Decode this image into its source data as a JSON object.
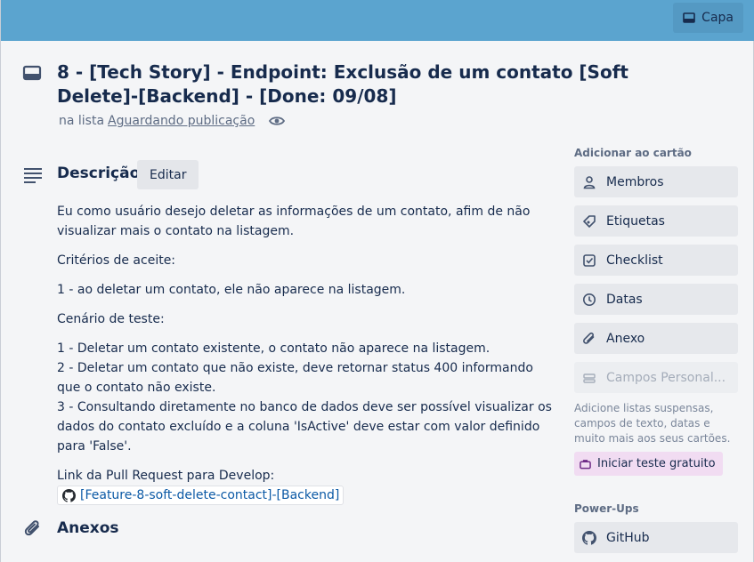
{
  "cover": {
    "button_label": "Capa",
    "color": "#5ba4cf"
  },
  "card": {
    "title": "8 - [Tech Story] - Endpoint: Exclusão de um contato [Soft Delete]-[Backend] - [Done: 09/08]",
    "in_list_prefix": "na lista",
    "list_name": "Aguardando publicação"
  },
  "description": {
    "heading": "Descrição",
    "edit_label": "Editar",
    "paragraphs": [
      "Eu como usuário desejo deletar as informações de um contato, afim de não visualizar mais o contato na listagem.",
      "Critérios de aceite:",
      "1 - ao deletar um contato, ele não aparece na listagem.",
      "Cenário de teste:"
    ],
    "scenarios": [
      "1 - Deletar um contato existente, o contato não aparece na listagem.",
      "2 - Deletar um contato que não existe, deve retornar status 400 informando que o contato não existe.",
      "3 - Consultando diretamente no banco de dados deve ser possível visualizar os dados do contato excluído e a coluna 'IsActive' deve estar com valor definido para 'False'."
    ],
    "pr_prefix": "Link da Pull Request para Develop:",
    "pr_link": "[Feature-8-soft-delete-contact]-[Backend]"
  },
  "attachments": {
    "heading": "Anexos"
  },
  "sidebar": {
    "add_heading": "Adicionar ao cartão",
    "buttons": [
      {
        "label": "Membros",
        "icon": "person-icon"
      },
      {
        "label": "Etiquetas",
        "icon": "tag-icon"
      },
      {
        "label": "Checklist",
        "icon": "checkbox-icon"
      },
      {
        "label": "Datas",
        "icon": "clock-icon"
      },
      {
        "label": "Anexo",
        "icon": "paperclip-icon"
      },
      {
        "label": "Campos Personal...",
        "icon": "fields-icon"
      }
    ],
    "note": "Adicione listas suspensas, campos de texto, datas e muito mais aos seus cartões.",
    "trial_label": "Iniciar teste gratuito",
    "powerups_heading": "Power-Ups",
    "github_label": "GitHub"
  }
}
